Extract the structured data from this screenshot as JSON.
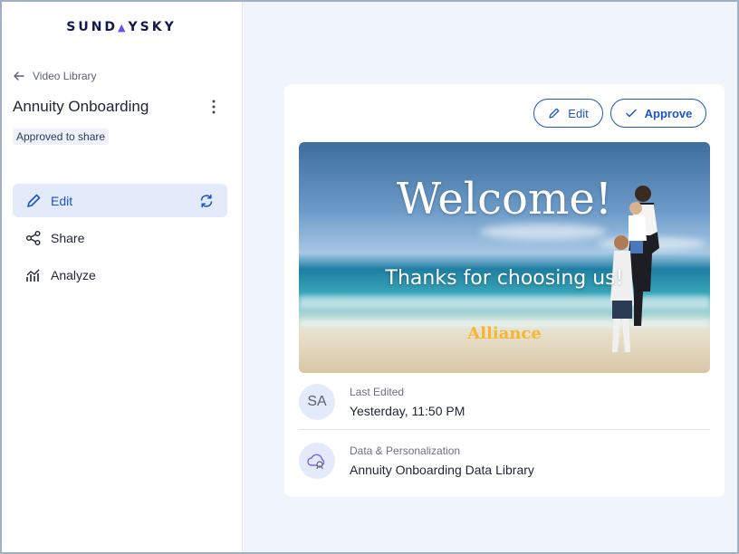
{
  "sidebar": {
    "logo": "SUNDAYSKY",
    "back_label": "Video Library",
    "page_title": "Annuity Onboarding",
    "status_badge": "Approved to share",
    "nav": [
      {
        "label": "Edit",
        "icon": "pencil-icon",
        "active": true
      },
      {
        "label": "Share",
        "icon": "share-icon"
      },
      {
        "label": "Analyze",
        "icon": "chart-icon"
      }
    ]
  },
  "toolbar": {
    "edit_label": "Edit",
    "approve_label": "Approve"
  },
  "video": {
    "headline": "Welcome!",
    "subtitle": "Thanks for choosing us!",
    "brand": "Alliance"
  },
  "details": {
    "last_edited": {
      "avatar": "SA",
      "label": "Last Edited",
      "value": "Yesterday, 11:50 PM"
    },
    "data": {
      "label": "Data & Personalization",
      "value": "Annuity Onboarding Data Library"
    }
  },
  "colors": {
    "accent": "#1a56c9",
    "logo_accent": "#6a4cf6",
    "active_bg": "#e3ebfa",
    "page_bg": "#f0f4fb"
  }
}
